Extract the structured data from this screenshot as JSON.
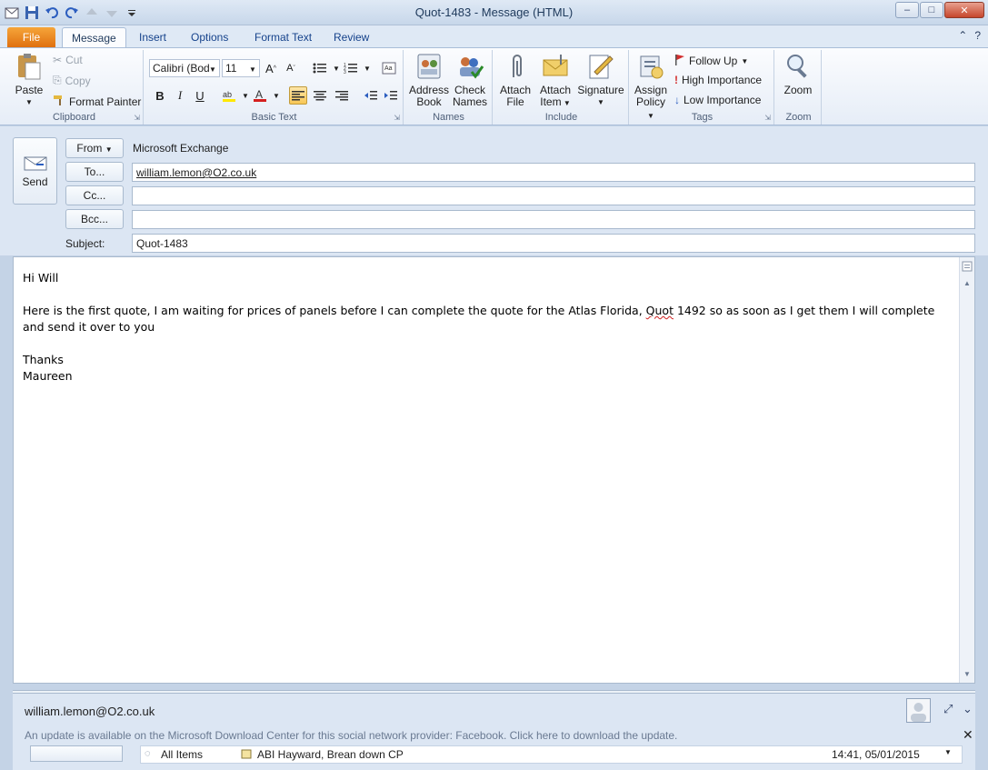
{
  "window": {
    "title": "Quot-1483  -  Message (HTML)",
    "minimize": "–",
    "maximize": "□",
    "close": "✕"
  },
  "tabs": {
    "file": "File",
    "items": [
      "Message",
      "Insert",
      "Options",
      "Format Text",
      "Review"
    ],
    "help": "?"
  },
  "ribbon": {
    "clipboard": {
      "label": "Clipboard",
      "paste": "Paste",
      "cut": "Cut",
      "copy": "Copy",
      "format_painter": "Format Painter"
    },
    "basic_text": {
      "label": "Basic Text",
      "font_name": "Calibri (Body)",
      "font_size": "11"
    },
    "names": {
      "label": "Names",
      "address_book_1": "Address",
      "address_book_2": "Book",
      "check_names_1": "Check",
      "check_names_2": "Names"
    },
    "include": {
      "label": "Include",
      "attach_file_1": "Attach",
      "attach_file_2": "File",
      "attach_item_1": "Attach",
      "attach_item_2": "Item",
      "signature": "Signature"
    },
    "tags": {
      "label": "Tags",
      "assign_policy_1": "Assign",
      "assign_policy_2": "Policy",
      "follow_up": "Follow Up",
      "high_importance": "High Importance",
      "low_importance": "Low Importance"
    },
    "zoom": {
      "label": "Zoom",
      "zoom": "Zoom"
    }
  },
  "header": {
    "send": "Send",
    "from_button": "From",
    "from_value": "Microsoft Exchange",
    "to_button": "To...",
    "to_value": "william.lemon@O2.co.uk",
    "cc_button": "Cc...",
    "cc_value": "",
    "bcc_button": "Bcc...",
    "bcc_value": "",
    "subject_label": "Subject:",
    "subject_value": "Quot-1483"
  },
  "body": {
    "greeting": "Hi Will",
    "para_before": "Here is the first quote, I am waiting for prices of panels before I can complete the quote for the Atlas Florida, ",
    "para_misspelled": "Quot",
    "para_after": " 1492 so as soon as I get them I will complete and send it over to you",
    "closing": "Thanks",
    "signature": "Maureen"
  },
  "people_pane": {
    "contact": "william.lemon@O2.co.uk",
    "update_notice": "An update is available on the Microsoft Download Center for this social network provider: Facebook. Click here to download the update.",
    "filter": "All Items",
    "activity_item": "ABI Hayward, Brean down CP",
    "activity_time": "14:41, 05/01/2015"
  },
  "colors": {
    "file_tab": "#e0700f",
    "ribbon_bg": "#e6edf7",
    "frame": "#c4d3e6"
  }
}
